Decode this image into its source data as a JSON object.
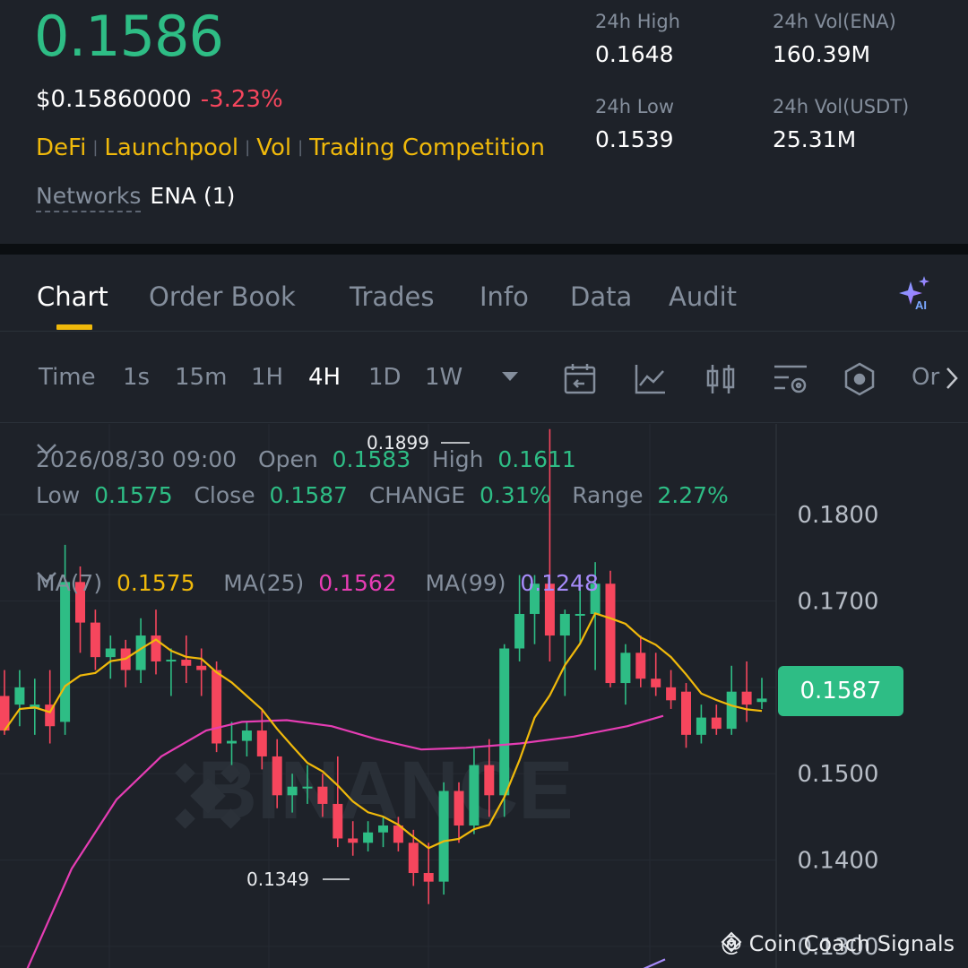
{
  "header": {
    "price": "0.1586",
    "price_usd": "$0.15860000",
    "change_pct": "-3.23%",
    "tags": [
      "DeFi",
      "Launchpool",
      "Vol",
      "Trading Competition"
    ],
    "networks_label": "Networks",
    "networks_value": "ENA (1)",
    "stats": {
      "high_label": "24h High",
      "high_value": "0.1648",
      "low_label": "24h Low",
      "low_value": "0.1539",
      "vol_base_label": "24h Vol(ENA)",
      "vol_base_value": "160.39M",
      "vol_quote_label": "24h Vol(USDT)",
      "vol_quote_value": "25.31M"
    }
  },
  "tabs": [
    "Chart",
    "Order Book",
    "Trades",
    "Info",
    "Data",
    "Audit"
  ],
  "active_tab": "Chart",
  "timeframes": {
    "label": "Time",
    "items": [
      "1s",
      "15m",
      "1H",
      "4H",
      "1D",
      "1W"
    ],
    "active": "4H",
    "overflow_label": "Or"
  },
  "toolbar_icons": [
    "calendar-back-icon",
    "indicator-icon",
    "candle-type-icon",
    "chart-settings-icon",
    "hexagon-icon"
  ],
  "candle_info": {
    "datetime": "2026/08/30 09:00",
    "open_label": "Open",
    "open": "0.1583",
    "high_label": "High",
    "high": "0.1611",
    "low_label": "Low",
    "low": "0.1575",
    "close_label": "Close",
    "close": "0.1587",
    "change_label": "CHANGE",
    "change": "0.31%",
    "range_label": "Range",
    "range": "2.27%"
  },
  "ma_legend": {
    "ma7_label": "MA(7)",
    "ma7": "0.1575",
    "ma25_label": "MA(25)",
    "ma25": "0.1562",
    "ma99_label": "MA(99)",
    "ma99": "0.1248"
  },
  "current_price_tag": "0.1587",
  "annotations": {
    "max": "0.1899",
    "min": "0.1349"
  },
  "watermark": "BINANCE",
  "credit": "@ Coin Coach Signals",
  "colors": {
    "up": "#2ebd85",
    "down": "#f6465d",
    "accent": "#f0b90b",
    "ma7": "#f0b90b",
    "ma25": "#e63db4",
    "ma99": "#a78bfa"
  },
  "chart_data": {
    "type": "candlestick",
    "y_ticks": [
      "0.1800",
      "0.1700",
      "0.1500",
      "0.1400",
      "0.1300"
    ],
    "ylim": [
      0.1275,
      0.1905
    ],
    "candles": [
      {
        "o": 0.159,
        "h": 0.162,
        "l": 0.1545,
        "c": 0.155
      },
      {
        "o": 0.158,
        "h": 0.162,
        "l": 0.1555,
        "c": 0.16
      },
      {
        "o": 0.1575,
        "h": 0.161,
        "l": 0.1545,
        "c": 0.158
      },
      {
        "o": 0.158,
        "h": 0.162,
        "l": 0.1535,
        "c": 0.1555
      },
      {
        "o": 0.156,
        "h": 0.1765,
        "l": 0.1545,
        "c": 0.1722
      },
      {
        "o": 0.1722,
        "h": 0.174,
        "l": 0.164,
        "c": 0.1675
      },
      {
        "o": 0.1675,
        "h": 0.169,
        "l": 0.162,
        "c": 0.1635
      },
      {
        "o": 0.1635,
        "h": 0.166,
        "l": 0.161,
        "c": 0.1645
      },
      {
        "o": 0.1645,
        "h": 0.1655,
        "l": 0.16,
        "c": 0.162
      },
      {
        "o": 0.162,
        "h": 0.168,
        "l": 0.1605,
        "c": 0.166
      },
      {
        "o": 0.166,
        "h": 0.169,
        "l": 0.1615,
        "c": 0.163
      },
      {
        "o": 0.163,
        "h": 0.1645,
        "l": 0.159,
        "c": 0.1632
      },
      {
        "o": 0.1632,
        "h": 0.166,
        "l": 0.1605,
        "c": 0.1625
      },
      {
        "o": 0.1625,
        "h": 0.1645,
        "l": 0.159,
        "c": 0.162
      },
      {
        "o": 0.162,
        "h": 0.163,
        "l": 0.1525,
        "c": 0.1535
      },
      {
        "o": 0.1535,
        "h": 0.156,
        "l": 0.151,
        "c": 0.1538
      },
      {
        "o": 0.1538,
        "h": 0.156,
        "l": 0.152,
        "c": 0.155
      },
      {
        "o": 0.155,
        "h": 0.1575,
        "l": 0.1505,
        "c": 0.152
      },
      {
        "o": 0.152,
        "h": 0.154,
        "l": 0.146,
        "c": 0.1475
      },
      {
        "o": 0.1475,
        "h": 0.15,
        "l": 0.1455,
        "c": 0.1485
      },
      {
        "o": 0.1485,
        "h": 0.151,
        "l": 0.1465,
        "c": 0.1485
      },
      {
        "o": 0.1485,
        "h": 0.15,
        "l": 0.145,
        "c": 0.1465
      },
      {
        "o": 0.1465,
        "h": 0.152,
        "l": 0.1415,
        "c": 0.1425
      },
      {
        "o": 0.1425,
        "h": 0.1445,
        "l": 0.1405,
        "c": 0.142
      },
      {
        "o": 0.142,
        "h": 0.1445,
        "l": 0.141,
        "c": 0.1432
      },
      {
        "o": 0.1432,
        "h": 0.145,
        "l": 0.1415,
        "c": 0.144
      },
      {
        "o": 0.144,
        "h": 0.145,
        "l": 0.141,
        "c": 0.142
      },
      {
        "o": 0.142,
        "h": 0.1435,
        "l": 0.137,
        "c": 0.1385
      },
      {
        "o": 0.1385,
        "h": 0.142,
        "l": 0.1349,
        "c": 0.1375
      },
      {
        "o": 0.1375,
        "h": 0.149,
        "l": 0.136,
        "c": 0.148
      },
      {
        "o": 0.148,
        "h": 0.149,
        "l": 0.142,
        "c": 0.144
      },
      {
        "o": 0.144,
        "h": 0.153,
        "l": 0.143,
        "c": 0.151
      },
      {
        "o": 0.151,
        "h": 0.154,
        "l": 0.145,
        "c": 0.1475
      },
      {
        "o": 0.1475,
        "h": 0.165,
        "l": 0.145,
        "c": 0.1645
      },
      {
        "o": 0.1645,
        "h": 0.173,
        "l": 0.163,
        "c": 0.1685
      },
      {
        "o": 0.1685,
        "h": 0.173,
        "l": 0.165,
        "c": 0.172
      },
      {
        "o": 0.172,
        "h": 0.1899,
        "l": 0.163,
        "c": 0.166
      },
      {
        "o": 0.166,
        "h": 0.169,
        "l": 0.159,
        "c": 0.1685
      },
      {
        "o": 0.1685,
        "h": 0.1715,
        "l": 0.165,
        "c": 0.1685
      },
      {
        "o": 0.1685,
        "h": 0.1745,
        "l": 0.162,
        "c": 0.172
      },
      {
        "o": 0.172,
        "h": 0.1735,
        "l": 0.16,
        "c": 0.1605
      },
      {
        "o": 0.1605,
        "h": 0.165,
        "l": 0.158,
        "c": 0.164
      },
      {
        "o": 0.164,
        "h": 0.166,
        "l": 0.16,
        "c": 0.161
      },
      {
        "o": 0.161,
        "h": 0.164,
        "l": 0.159,
        "c": 0.16
      },
      {
        "o": 0.16,
        "h": 0.162,
        "l": 0.1575,
        "c": 0.1585
      },
      {
        "o": 0.1595,
        "h": 0.1605,
        "l": 0.153,
        "c": 0.1545
      },
      {
        "o": 0.1545,
        "h": 0.158,
        "l": 0.1535,
        "c": 0.1565
      },
      {
        "o": 0.1565,
        "h": 0.158,
        "l": 0.1545,
        "c": 0.1552
      },
      {
        "o": 0.1552,
        "h": 0.1625,
        "l": 0.1545,
        "c": 0.1595
      },
      {
        "o": 0.1595,
        "h": 0.163,
        "l": 0.156,
        "c": 0.158
      },
      {
        "o": 0.1583,
        "h": 0.1611,
        "l": 0.1575,
        "c": 0.1587
      }
    ]
  }
}
